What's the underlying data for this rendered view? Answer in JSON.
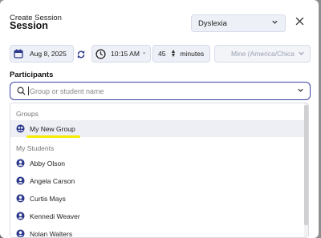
{
  "header": {
    "title_small": "Create Session",
    "title_big": "Session"
  },
  "subject": {
    "selected": "Dyslexia"
  },
  "schedule": {
    "date": "Aug 8, 2025",
    "time": "10:15 AM",
    "separator": "-",
    "duration_value": "45",
    "duration_unit": "minutes",
    "timezone": "Mine (America/Chica"
  },
  "participants": {
    "label": "Participants",
    "search_placeholder": "Group or student name"
  },
  "dropdown": {
    "groups_header": "Groups",
    "groups": [
      {
        "label": "My New Group",
        "highlighted": true
      }
    ],
    "students_header": "My Students",
    "students": [
      {
        "label": "Abby Olson"
      },
      {
        "label": "Angela Carson"
      },
      {
        "label": "Curtis Mays"
      },
      {
        "label": "Kennedi Weaver"
      },
      {
        "label": "Nolan Walters"
      }
    ]
  },
  "colors": {
    "accent": "#2d3a8c",
    "highlight_underline": "#f5ec00"
  }
}
